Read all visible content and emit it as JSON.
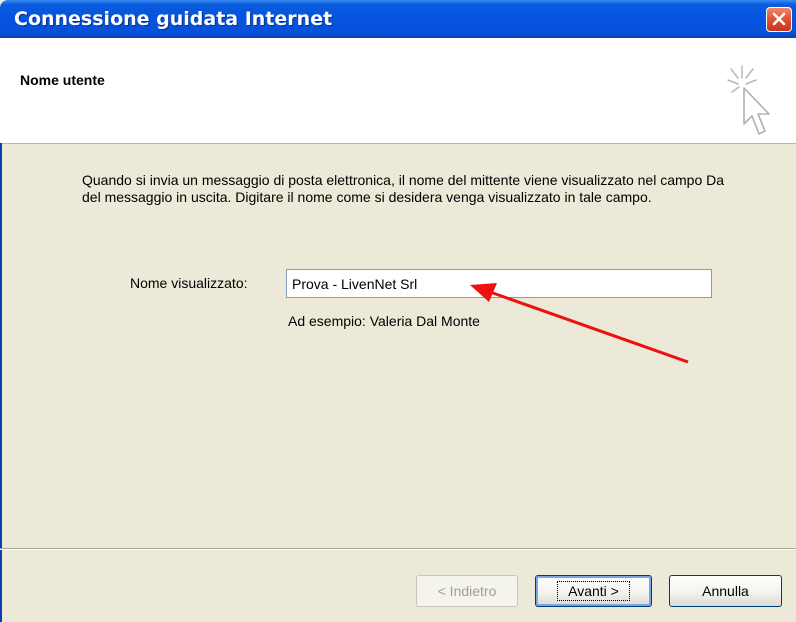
{
  "window": {
    "title": "Connessione guidata Internet",
    "colors": {
      "title_bar": "#0454e0",
      "close_button": "#e15433",
      "dialog_bg": "#ece9d8",
      "annotation_arrow": "#ee1111"
    }
  },
  "header": {
    "title": "Nome utente",
    "icon": "wizard-cursor-sparkle-icon"
  },
  "body": {
    "description": "Quando si invia un messaggio di posta elettronica, il nome del mittente viene visualizzato nel campo Da del messaggio in uscita. Digitare il nome come si desidera venga visualizzato in tale campo.",
    "display_name_label": "Nome visualizzato:",
    "display_name_value": "Prova - LivenNet Srl",
    "example_text": "Ad esempio: Valeria Dal Monte"
  },
  "footer": {
    "back_label": "< Indietro",
    "next_label": "Avanti >",
    "cancel_label": "Annulla"
  }
}
